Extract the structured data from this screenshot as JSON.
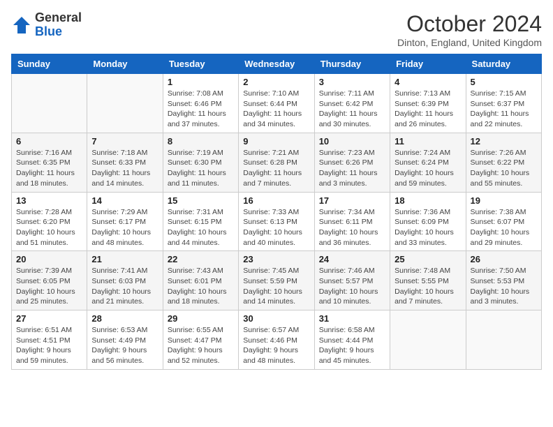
{
  "logo": {
    "general": "General",
    "blue": "Blue"
  },
  "header": {
    "month": "October 2024",
    "location": "Dinton, England, United Kingdom"
  },
  "weekdays": [
    "Sunday",
    "Monday",
    "Tuesday",
    "Wednesday",
    "Thursday",
    "Friday",
    "Saturday"
  ],
  "weeks": [
    [
      {
        "day": "",
        "sunrise": "",
        "sunset": "",
        "daylight": ""
      },
      {
        "day": "",
        "sunrise": "",
        "sunset": "",
        "daylight": ""
      },
      {
        "day": "1",
        "sunrise": "Sunrise: 7:08 AM",
        "sunset": "Sunset: 6:46 PM",
        "daylight": "Daylight: 11 hours and 37 minutes."
      },
      {
        "day": "2",
        "sunrise": "Sunrise: 7:10 AM",
        "sunset": "Sunset: 6:44 PM",
        "daylight": "Daylight: 11 hours and 34 minutes."
      },
      {
        "day": "3",
        "sunrise": "Sunrise: 7:11 AM",
        "sunset": "Sunset: 6:42 PM",
        "daylight": "Daylight: 11 hours and 30 minutes."
      },
      {
        "day": "4",
        "sunrise": "Sunrise: 7:13 AM",
        "sunset": "Sunset: 6:39 PM",
        "daylight": "Daylight: 11 hours and 26 minutes."
      },
      {
        "day": "5",
        "sunrise": "Sunrise: 7:15 AM",
        "sunset": "Sunset: 6:37 PM",
        "daylight": "Daylight: 11 hours and 22 minutes."
      }
    ],
    [
      {
        "day": "6",
        "sunrise": "Sunrise: 7:16 AM",
        "sunset": "Sunset: 6:35 PM",
        "daylight": "Daylight: 11 hours and 18 minutes."
      },
      {
        "day": "7",
        "sunrise": "Sunrise: 7:18 AM",
        "sunset": "Sunset: 6:33 PM",
        "daylight": "Daylight: 11 hours and 14 minutes."
      },
      {
        "day": "8",
        "sunrise": "Sunrise: 7:19 AM",
        "sunset": "Sunset: 6:30 PM",
        "daylight": "Daylight: 11 hours and 11 minutes."
      },
      {
        "day": "9",
        "sunrise": "Sunrise: 7:21 AM",
        "sunset": "Sunset: 6:28 PM",
        "daylight": "Daylight: 11 hours and 7 minutes."
      },
      {
        "day": "10",
        "sunrise": "Sunrise: 7:23 AM",
        "sunset": "Sunset: 6:26 PM",
        "daylight": "Daylight: 11 hours and 3 minutes."
      },
      {
        "day": "11",
        "sunrise": "Sunrise: 7:24 AM",
        "sunset": "Sunset: 6:24 PM",
        "daylight": "Daylight: 10 hours and 59 minutes."
      },
      {
        "day": "12",
        "sunrise": "Sunrise: 7:26 AM",
        "sunset": "Sunset: 6:22 PM",
        "daylight": "Daylight: 10 hours and 55 minutes."
      }
    ],
    [
      {
        "day": "13",
        "sunrise": "Sunrise: 7:28 AM",
        "sunset": "Sunset: 6:20 PM",
        "daylight": "Daylight: 10 hours and 51 minutes."
      },
      {
        "day": "14",
        "sunrise": "Sunrise: 7:29 AM",
        "sunset": "Sunset: 6:17 PM",
        "daylight": "Daylight: 10 hours and 48 minutes."
      },
      {
        "day": "15",
        "sunrise": "Sunrise: 7:31 AM",
        "sunset": "Sunset: 6:15 PM",
        "daylight": "Daylight: 10 hours and 44 minutes."
      },
      {
        "day": "16",
        "sunrise": "Sunrise: 7:33 AM",
        "sunset": "Sunset: 6:13 PM",
        "daylight": "Daylight: 10 hours and 40 minutes."
      },
      {
        "day": "17",
        "sunrise": "Sunrise: 7:34 AM",
        "sunset": "Sunset: 6:11 PM",
        "daylight": "Daylight: 10 hours and 36 minutes."
      },
      {
        "day": "18",
        "sunrise": "Sunrise: 7:36 AM",
        "sunset": "Sunset: 6:09 PM",
        "daylight": "Daylight: 10 hours and 33 minutes."
      },
      {
        "day": "19",
        "sunrise": "Sunrise: 7:38 AM",
        "sunset": "Sunset: 6:07 PM",
        "daylight": "Daylight: 10 hours and 29 minutes."
      }
    ],
    [
      {
        "day": "20",
        "sunrise": "Sunrise: 7:39 AM",
        "sunset": "Sunset: 6:05 PM",
        "daylight": "Daylight: 10 hours and 25 minutes."
      },
      {
        "day": "21",
        "sunrise": "Sunrise: 7:41 AM",
        "sunset": "Sunset: 6:03 PM",
        "daylight": "Daylight: 10 hours and 21 minutes."
      },
      {
        "day": "22",
        "sunrise": "Sunrise: 7:43 AM",
        "sunset": "Sunset: 6:01 PM",
        "daylight": "Daylight: 10 hours and 18 minutes."
      },
      {
        "day": "23",
        "sunrise": "Sunrise: 7:45 AM",
        "sunset": "Sunset: 5:59 PM",
        "daylight": "Daylight: 10 hours and 14 minutes."
      },
      {
        "day": "24",
        "sunrise": "Sunrise: 7:46 AM",
        "sunset": "Sunset: 5:57 PM",
        "daylight": "Daylight: 10 hours and 10 minutes."
      },
      {
        "day": "25",
        "sunrise": "Sunrise: 7:48 AM",
        "sunset": "Sunset: 5:55 PM",
        "daylight": "Daylight: 10 hours and 7 minutes."
      },
      {
        "day": "26",
        "sunrise": "Sunrise: 7:50 AM",
        "sunset": "Sunset: 5:53 PM",
        "daylight": "Daylight: 10 hours and 3 minutes."
      }
    ],
    [
      {
        "day": "27",
        "sunrise": "Sunrise: 6:51 AM",
        "sunset": "Sunset: 4:51 PM",
        "daylight": "Daylight: 9 hours and 59 minutes."
      },
      {
        "day": "28",
        "sunrise": "Sunrise: 6:53 AM",
        "sunset": "Sunset: 4:49 PM",
        "daylight": "Daylight: 9 hours and 56 minutes."
      },
      {
        "day": "29",
        "sunrise": "Sunrise: 6:55 AM",
        "sunset": "Sunset: 4:47 PM",
        "daylight": "Daylight: 9 hours and 52 minutes."
      },
      {
        "day": "30",
        "sunrise": "Sunrise: 6:57 AM",
        "sunset": "Sunset: 4:46 PM",
        "daylight": "Daylight: 9 hours and 48 minutes."
      },
      {
        "day": "31",
        "sunrise": "Sunrise: 6:58 AM",
        "sunset": "Sunset: 4:44 PM",
        "daylight": "Daylight: 9 hours and 45 minutes."
      },
      {
        "day": "",
        "sunrise": "",
        "sunset": "",
        "daylight": ""
      },
      {
        "day": "",
        "sunrise": "",
        "sunset": "",
        "daylight": ""
      }
    ]
  ]
}
